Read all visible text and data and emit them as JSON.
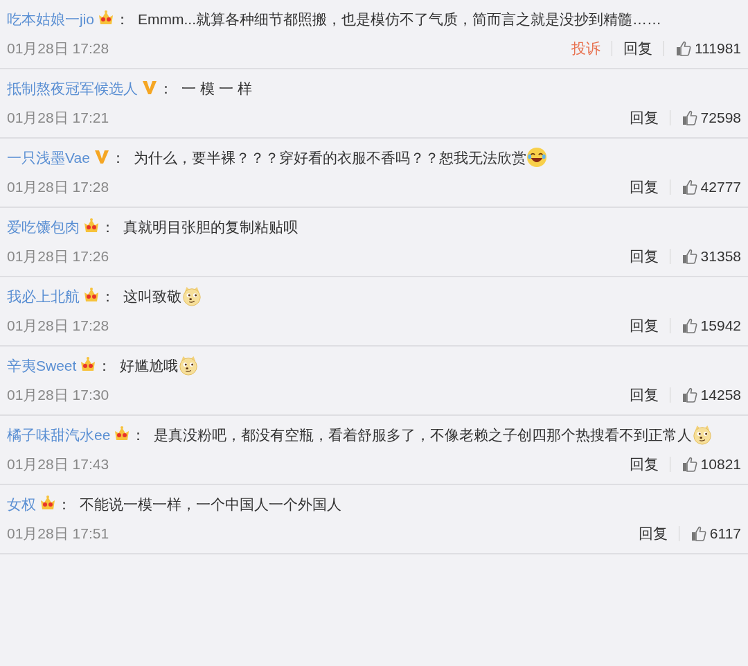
{
  "comments": [
    {
      "user": "吃本姑娘一jio",
      "badge": {
        "kind": "crown"
      },
      "colon": "：",
      "text": "Emmm...就算各种细节都照搬，也是模仿不了气质，简而言之就是没抄到精髓……",
      "time": "01月28日 17:28",
      "report": "投诉",
      "reply": "回复",
      "likes": "111981"
    },
    {
      "user": "抵制熬夜冠军候选人",
      "badge": {
        "kind": "v"
      },
      "colon": "：",
      "text": "一 模 一 样",
      "time": "01月28日 17:21",
      "reply": "回复",
      "likes": "72598"
    },
    {
      "user": "一只浅墨Vae",
      "badge": {
        "kind": "v"
      },
      "colon": "：",
      "text": "为什么，要半裸？？？穿好看的衣服不香吗？？恕我无法欣赏",
      "emoji": {
        "kind": "laugh"
      },
      "time": "01月28日 17:28",
      "reply": "回复",
      "likes": "42777"
    },
    {
      "user": "爱吃馕包肉",
      "badge": {
        "kind": "crown"
      },
      "colon": "：",
      "text": "真就明目张胆的复制粘贴呗",
      "time": "01月28日 17:26",
      "reply": "回复",
      "likes": "31358"
    },
    {
      "user": "我必上北航",
      "badge": {
        "kind": "crown"
      },
      "colon": "：",
      "text": "这叫致敬",
      "emoji": {
        "kind": "doge"
      },
      "time": "01月28日 17:28",
      "reply": "回复",
      "likes": "15942"
    },
    {
      "user": "辛夷Sweet",
      "badge": {
        "kind": "crown"
      },
      "colon": "：",
      "text": "好尴尬哦",
      "emoji": {
        "kind": "doge"
      },
      "time": "01月28日 17:30",
      "reply": "回复",
      "likes": "14258"
    },
    {
      "user": "橘子味甜汽水ee",
      "badge": {
        "kind": "crown"
      },
      "colon": "：",
      "text": "是真没粉吧，都没有空瓶，看着舒服多了，不像老赖之子创四那个热搜看不到正常人",
      "emoji": {
        "kind": "doge"
      },
      "time": "01月28日 17:43",
      "reply": "回复",
      "likes": "10821"
    },
    {
      "user": "女权",
      "badge": {
        "kind": "crown"
      },
      "colon": "：",
      "text": "不能说一模一样，一个中国人一个外国人",
      "time": "01月28日 17:51",
      "reply": "回复",
      "likes": "6117"
    }
  ]
}
